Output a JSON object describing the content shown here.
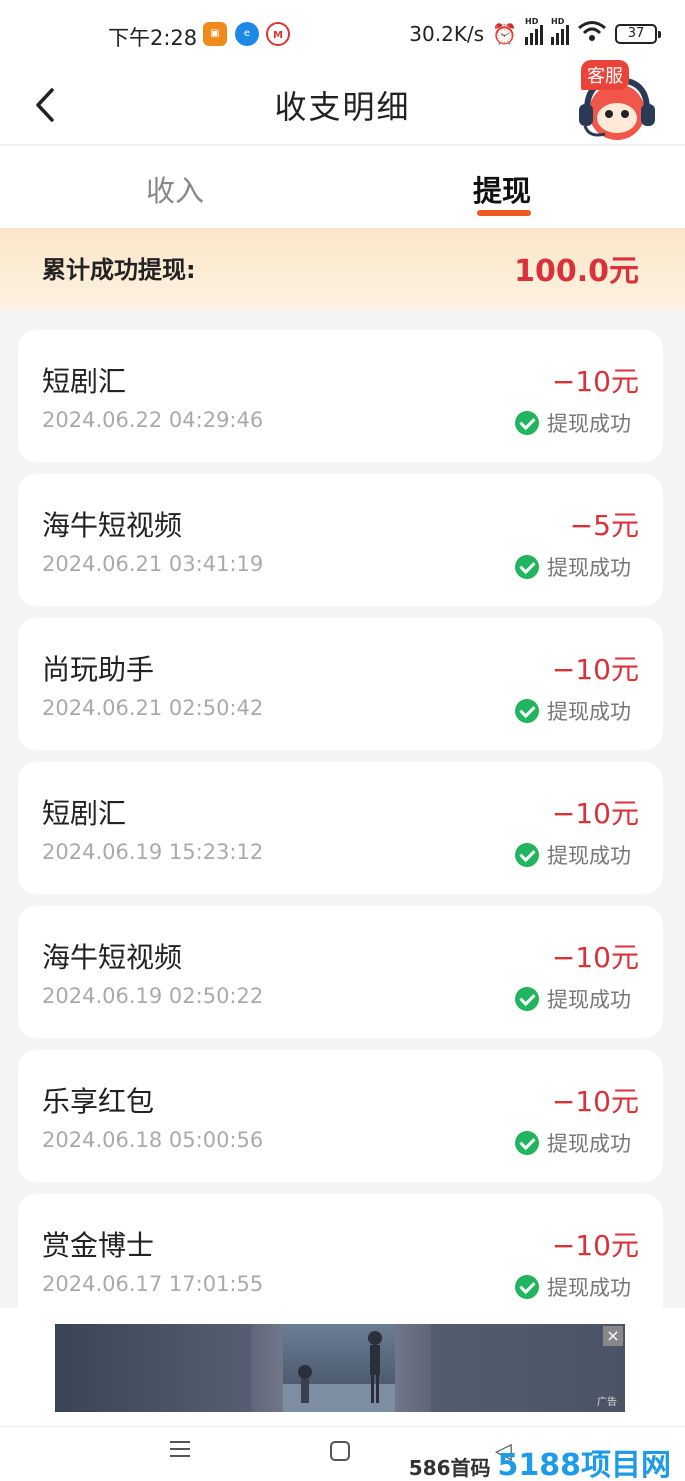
{
  "status_bar": {
    "time": "下午2:28",
    "net_speed": "30.2K/s",
    "battery": "37",
    "signal_label": "HD"
  },
  "header": {
    "title": "收支明细",
    "service_badge": "客服"
  },
  "tabs": [
    {
      "label": "收入",
      "active": false
    },
    {
      "label": "提现",
      "active": true
    }
  ],
  "summary": {
    "label": "累计成功提现:",
    "value": "100.0元"
  },
  "records": [
    {
      "name": "短剧汇",
      "time": "2024.06.22 04:29:46",
      "amount": "−10元",
      "status": "提现成功"
    },
    {
      "name": "海牛短视频",
      "time": "2024.06.21 03:41:19",
      "amount": "−5元",
      "status": "提现成功"
    },
    {
      "name": "尚玩助手",
      "time": "2024.06.21 02:50:42",
      "amount": "−10元",
      "status": "提现成功"
    },
    {
      "name": "短剧汇",
      "time": "2024.06.19 15:23:12",
      "amount": "−10元",
      "status": "提现成功"
    },
    {
      "name": "海牛短视频",
      "time": "2024.06.19 02:50:22",
      "amount": "−10元",
      "status": "提现成功"
    },
    {
      "name": "乐享红包",
      "time": "2024.06.18 05:00:56",
      "amount": "−10元",
      "status": "提现成功"
    },
    {
      "name": "赏金博士",
      "time": "2024.06.17 17:01:55",
      "amount": "−10元",
      "status": "提现成功"
    }
  ],
  "ad": {
    "tag": "广告",
    "close": "×"
  },
  "watermark": {
    "prefix": "586首码",
    "logo": "5188项目网"
  },
  "colors": {
    "accent_orange": "#f05a1f",
    "amount_red": "#d9323a",
    "success_green": "#21b55f"
  }
}
